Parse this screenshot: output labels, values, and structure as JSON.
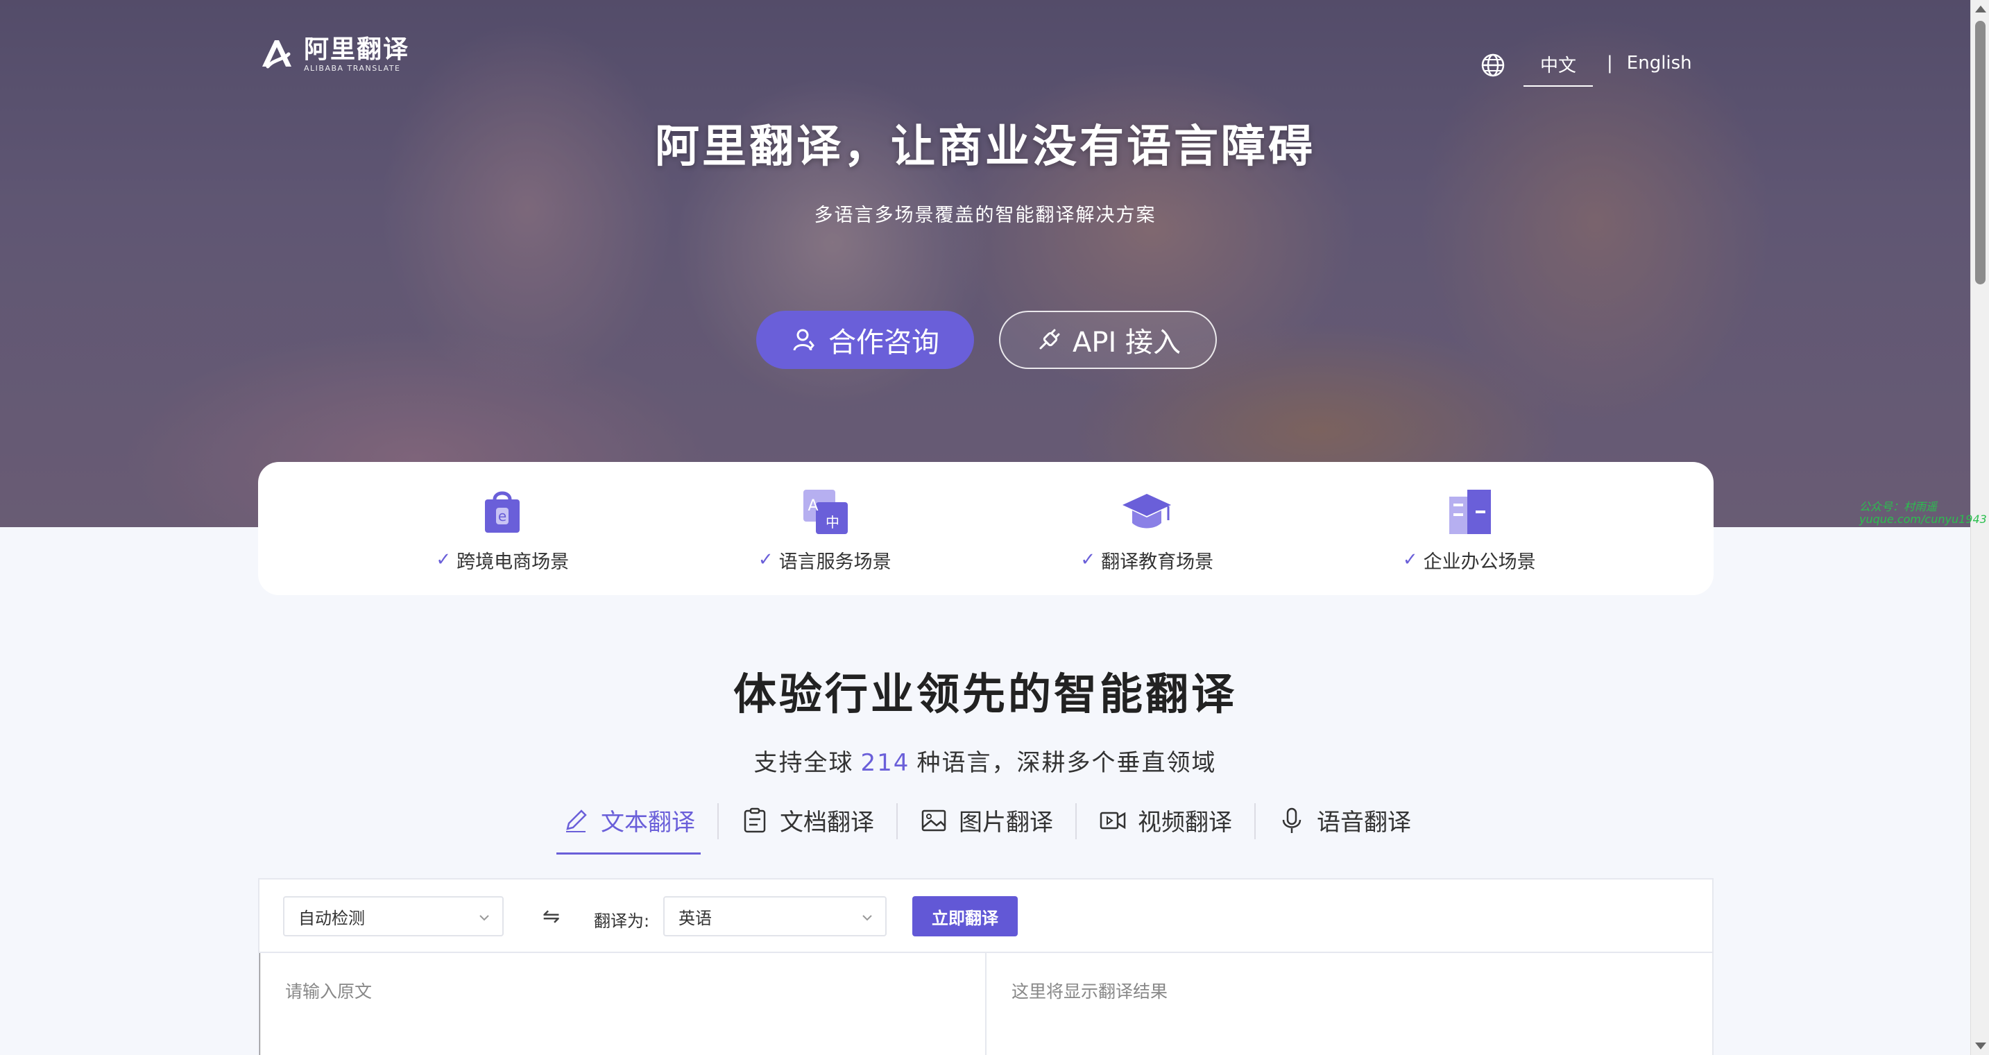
{
  "header": {
    "logo_cn": "阿里翻译",
    "logo_en": "ALIBABA TRANSLATE",
    "lang_zh": "中文",
    "lang_sep": "|",
    "lang_en": "English"
  },
  "hero": {
    "title": "阿里翻译，让商业没有语言障碍",
    "subtitle": "多语言多场景覆盖的智能翻译解决方案",
    "consult_label": "合作咨询",
    "api_label": "API 接入"
  },
  "watermark": {
    "line1": "公众号：村雨遥",
    "line2": "yuque.com/cunyu1943"
  },
  "scenarios": [
    {
      "label": "跨境电商场景",
      "icon": "shopping-bag-icon"
    },
    {
      "label": "语言服务场景",
      "icon": "translate-icon"
    },
    {
      "label": "翻译教育场景",
      "icon": "graduation-cap-icon"
    },
    {
      "label": "企业办公场景",
      "icon": "building-icon"
    }
  ],
  "section": {
    "title": "体验行业领先的智能翻译",
    "sub_before": "支持全球",
    "sub_num": "214",
    "sub_after": "种语言，深耕多个垂直领域"
  },
  "tabs": [
    {
      "label": "文本翻译",
      "icon": "pencil-icon",
      "active": true
    },
    {
      "label": "文档翻译",
      "icon": "document-icon",
      "active": false
    },
    {
      "label": "图片翻译",
      "icon": "image-icon",
      "active": false
    },
    {
      "label": "视频翻译",
      "icon": "video-icon",
      "active": false
    },
    {
      "label": "语音翻译",
      "icon": "microphone-icon",
      "active": false
    }
  ],
  "translator": {
    "source_lang": "自动检测",
    "swap_symbol": "⇋",
    "target_label": "翻译为:",
    "target_lang": "英语",
    "translate_button": "立即翻译",
    "source_placeholder": "请输入原文",
    "output_placeholder": "这里将显示翻译结果"
  },
  "colors": {
    "accent": "#6a5fd9",
    "button": "#6258d6"
  }
}
